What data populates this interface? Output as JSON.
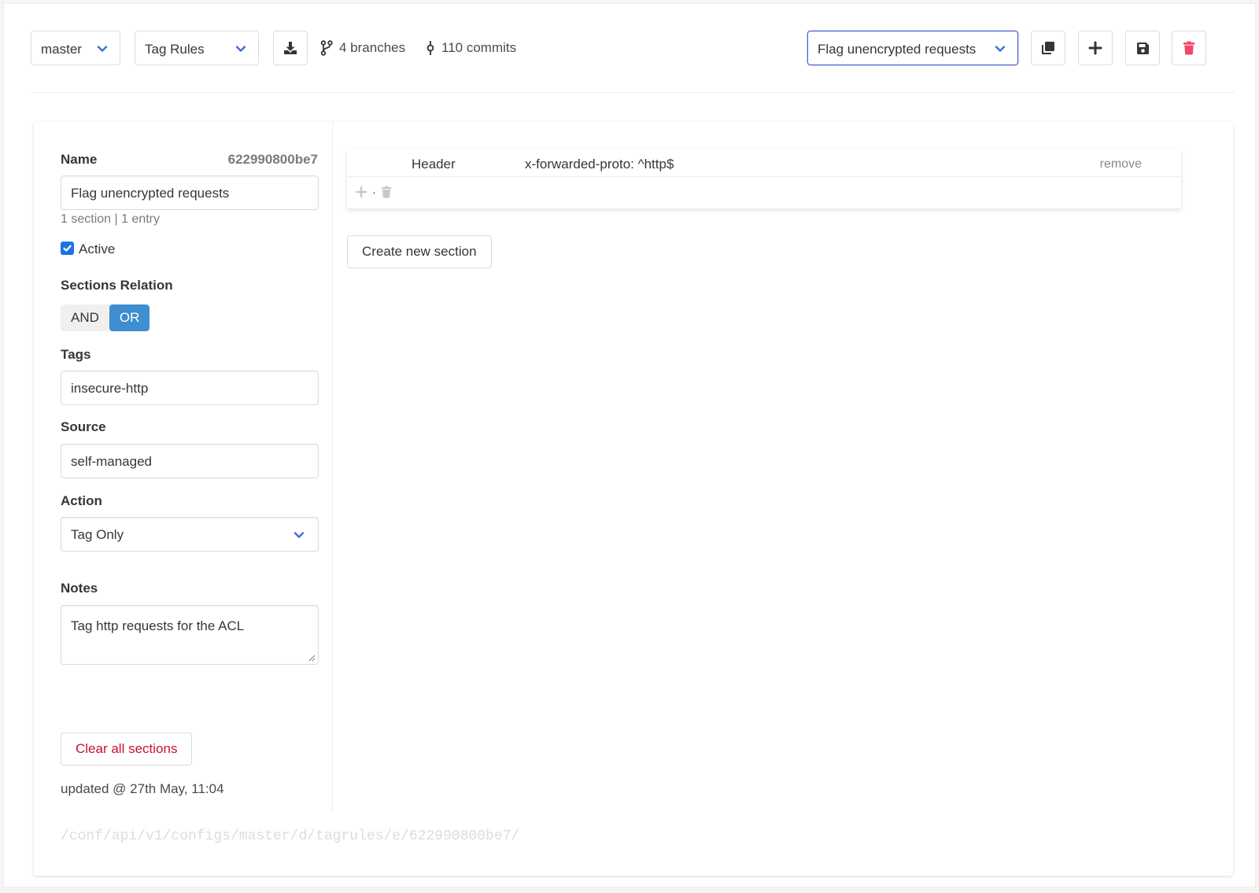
{
  "toolbar": {
    "branch": "master",
    "doc_type": "Tag Rules",
    "branches": "4 branches",
    "commits": "110 commits",
    "doc_selected": "Flag unencrypted requests"
  },
  "form": {
    "name_label": "Name",
    "doc_id": "622990800be7",
    "name_value": "Flag unencrypted requests",
    "summary": "1 section | 1 entry",
    "active_label": "Active",
    "active_checked": true,
    "relation_label": "Sections Relation",
    "relation_and": "AND",
    "relation_or": "OR",
    "relation_selected": "OR",
    "tags_label": "Tags",
    "tags_value": "insecure-http",
    "source_label": "Source",
    "source_value": "self-managed",
    "action_label": "Action",
    "action_value": "Tag Only",
    "notes_label": "Notes",
    "notes_value": "Tag http requests for the ACL",
    "clear_button": "Clear all sections",
    "updated": "updated @ 27th May, 11:04",
    "api_url": "/conf/api/v1/configs/master/d/tagrules/e/622990800be7/"
  },
  "sections": [
    {
      "entries": [
        {
          "type": "Header",
          "rule": "x-forwarded-proto: ^http$",
          "remove_label": "remove"
        }
      ],
      "tools_separator": "·"
    }
  ],
  "create_section_button": "Create new section",
  "colors": {
    "accent": "#3e8ed0",
    "danger": "#f14668",
    "danger_text": "#cc0f35",
    "focus_border": "#485fc7"
  },
  "icons": {
    "chevron": "chevron-down-icon",
    "download": "download-icon",
    "branch": "code-branch-icon",
    "commit": "code-commit-icon",
    "clone": "clone-icon",
    "add": "plus-icon",
    "save": "save-icon",
    "delete": "trash-icon"
  }
}
